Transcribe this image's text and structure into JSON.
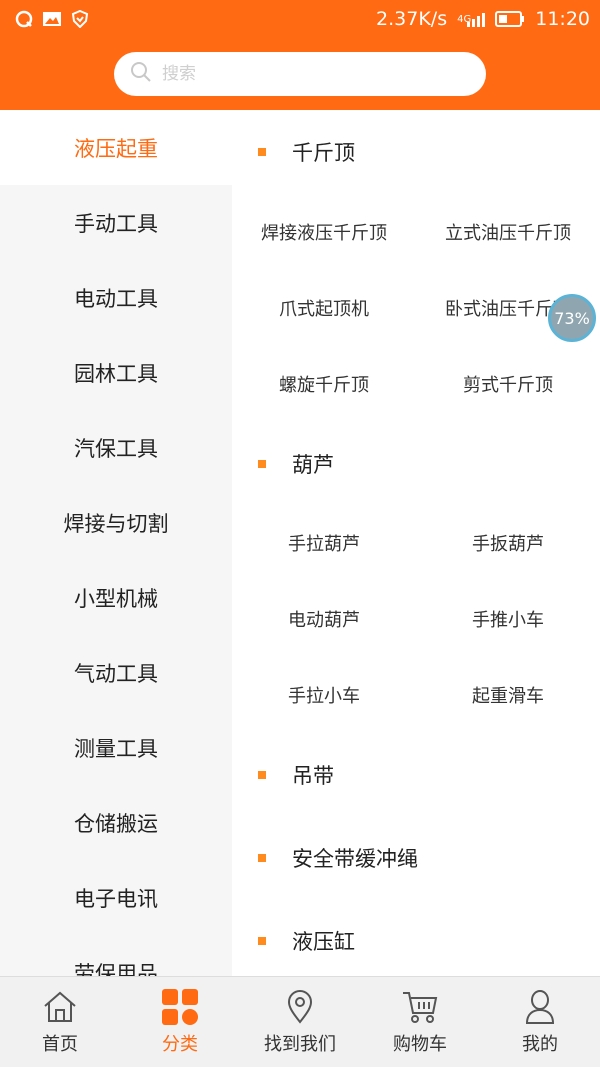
{
  "status_bar": {
    "speed": "2.37K/s",
    "network": "4G",
    "time": "11:20"
  },
  "search": {
    "placeholder": "搜索"
  },
  "sidebar": {
    "items": [
      {
        "label": "液压起重"
      },
      {
        "label": "手动工具"
      },
      {
        "label": "电动工具"
      },
      {
        "label": "园林工具"
      },
      {
        "label": "汽保工具"
      },
      {
        "label": "焊接与切割"
      },
      {
        "label": "小型机械"
      },
      {
        "label": "气动工具"
      },
      {
        "label": "测量工具"
      },
      {
        "label": "仓储搬运"
      },
      {
        "label": "电子电讯"
      },
      {
        "label": "劳保用品"
      }
    ]
  },
  "content": {
    "sections": [
      {
        "title": "千斤顶",
        "items": [
          "焊接液压千斤顶",
          "立式油压千斤顶",
          "爪式起顶机",
          "卧式油压千斤顶",
          "螺旋千斤顶",
          "剪式千斤顶"
        ]
      },
      {
        "title": "葫芦",
        "items": [
          "手拉葫芦",
          "手扳葫芦",
          "电动葫芦",
          "手推小车",
          "手拉小车",
          "起重滑车"
        ]
      },
      {
        "title": "吊带",
        "items": []
      },
      {
        "title": "安全带缓冲绳",
        "items": []
      },
      {
        "title": "液压缸",
        "items": []
      }
    ]
  },
  "float_badge": {
    "value": "73%"
  },
  "bottom_nav": {
    "items": [
      {
        "label": "首页",
        "icon": "home-icon"
      },
      {
        "label": "分类",
        "icon": "category-icon"
      },
      {
        "label": "找到我们",
        "icon": "location-icon"
      },
      {
        "label": "购物车",
        "icon": "cart-icon"
      },
      {
        "label": "我的",
        "icon": "user-icon"
      }
    ]
  },
  "colors": {
    "accent": "#ff6a12",
    "bullet": "#ff8a1e"
  }
}
